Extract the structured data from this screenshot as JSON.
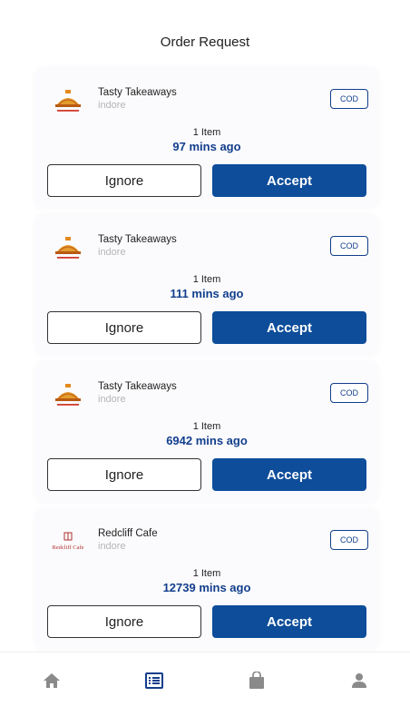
{
  "header": {
    "title": "Order Request"
  },
  "colors": {
    "primary": "#0d4d9a",
    "text_link": "#123e8c",
    "muted": "#b5b5b5",
    "nav_active": "#123e8c",
    "nav_inactive": "#8a8a8a"
  },
  "orders": [
    {
      "restaurant": "Tasty Takeaways",
      "city": "indore",
      "payment": "COD",
      "items": "1 Item",
      "ago": "97 mins ago",
      "logo": "tasty-takeaways-logo",
      "ignore_label": "Ignore",
      "accept_label": "Accept"
    },
    {
      "restaurant": "Tasty Takeaways",
      "city": "indore",
      "payment": "COD",
      "items": "1 Item",
      "ago": "111 mins ago",
      "logo": "tasty-takeaways-logo",
      "ignore_label": "Ignore",
      "accept_label": "Accept"
    },
    {
      "restaurant": "Tasty Takeaways",
      "city": "indore",
      "payment": "COD",
      "items": "1 Item",
      "ago": "6942 mins ago",
      "logo": "tasty-takeaways-logo",
      "ignore_label": "Ignore",
      "accept_label": "Accept"
    },
    {
      "restaurant": "Redcliff Cafe",
      "city": "indore",
      "payment": "COD",
      "items": "1 Item",
      "ago": "12739 mins ago",
      "logo": "redcliff-cafe-logo",
      "logo_text": "Redcliff Cafe",
      "ignore_label": "Ignore",
      "accept_label": "Accept"
    }
  ],
  "bottom_nav": [
    {
      "icon": "home-icon",
      "active": false
    },
    {
      "icon": "orders-list-icon",
      "active": true
    },
    {
      "icon": "shopping-bag-icon",
      "active": false
    },
    {
      "icon": "profile-icon",
      "active": false
    }
  ]
}
